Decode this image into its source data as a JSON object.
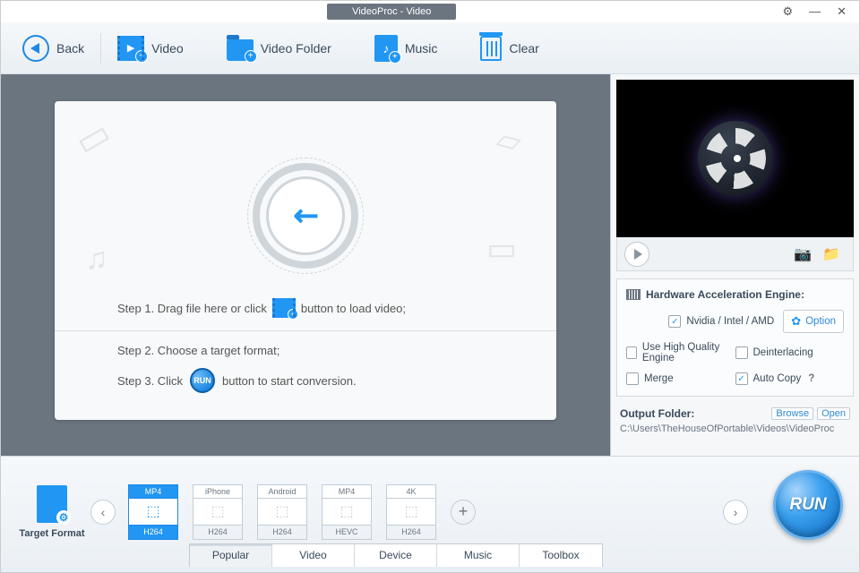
{
  "title": "VideoProc - Video",
  "toolbar": {
    "back": "Back",
    "video": "Video",
    "video_folder": "Video Folder",
    "music": "Music",
    "clear": "Clear"
  },
  "drop": {
    "step1a": "Step 1. Drag file here or click",
    "step1b": "button to load video;",
    "step2": "Step 2. Choose a target format;",
    "step3a": "Step 3. Click",
    "step3b": "button to start conversion.",
    "run_badge": "RUN"
  },
  "side": {
    "hw_title": "Hardware Acceleration Engine:",
    "nvidia": "Nvidia / Intel / AMD",
    "option": "Option",
    "hq": "Use High Quality Engine",
    "deint": "Deinterlacing",
    "merge": "Merge",
    "autocopy": "Auto Copy",
    "autocopy_q": "?",
    "output_label": "Output Folder:",
    "browse": "Browse",
    "open": "Open",
    "output_path": "C:\\Users\\TheHouseOfPortable\\Videos\\VideoProc"
  },
  "formats": {
    "target_label": "Target Format",
    "items": [
      {
        "top": "MP4",
        "bot": "H264",
        "sel": true
      },
      {
        "top": "iPhone",
        "bot": "H264",
        "sel": false
      },
      {
        "top": "Android",
        "bot": "H264",
        "sel": false
      },
      {
        "top": "MP4",
        "bot": "HEVC",
        "sel": false
      },
      {
        "top": "4K",
        "bot": "H264",
        "sel": false
      }
    ]
  },
  "tabs": [
    "Popular",
    "Video",
    "Device",
    "Music",
    "Toolbox"
  ],
  "run": "RUN"
}
